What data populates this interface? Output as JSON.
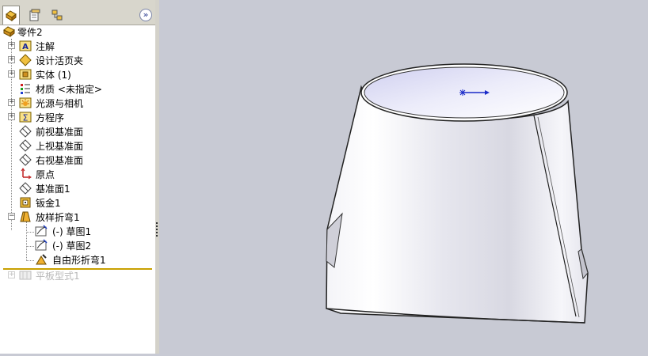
{
  "tabs": [
    {
      "name": "featuremanager-tab",
      "icon": "featuremanager-icon",
      "active": true
    },
    {
      "name": "propertymanager-tab",
      "icon": "propertymanager-icon",
      "active": false
    },
    {
      "name": "configurationmanager-tab",
      "icon": "configurationmanager-icon",
      "active": false
    }
  ],
  "tree": {
    "root": "零件2",
    "annotations": "注解",
    "design_binder": "设计活页夹",
    "solid_bodies": "实体 (1)",
    "material": "材质 <未指定>",
    "lights_cameras": "光源与相机",
    "equations": "方程序",
    "front_plane": "前视基准面",
    "top_plane": "上视基准面",
    "right_plane": "右视基准面",
    "origin": "原点",
    "plane1": "基准面1",
    "sheetmetal1": "钣金1",
    "lofted_bend1": "放样折弯1",
    "sketch1": "(-)  草图1",
    "sketch2": "(-)  草图2",
    "free_bend1": "自由形折弯1",
    "flat_pattern": "平板型式1"
  },
  "colors": {
    "accent": "#c8a000",
    "viewport_bg": "#c8cad4",
    "model_light": "#ffffff",
    "model_inner": "#dcdcf4"
  },
  "model": {
    "description_icon": "sketch-point-arrow-icon"
  }
}
